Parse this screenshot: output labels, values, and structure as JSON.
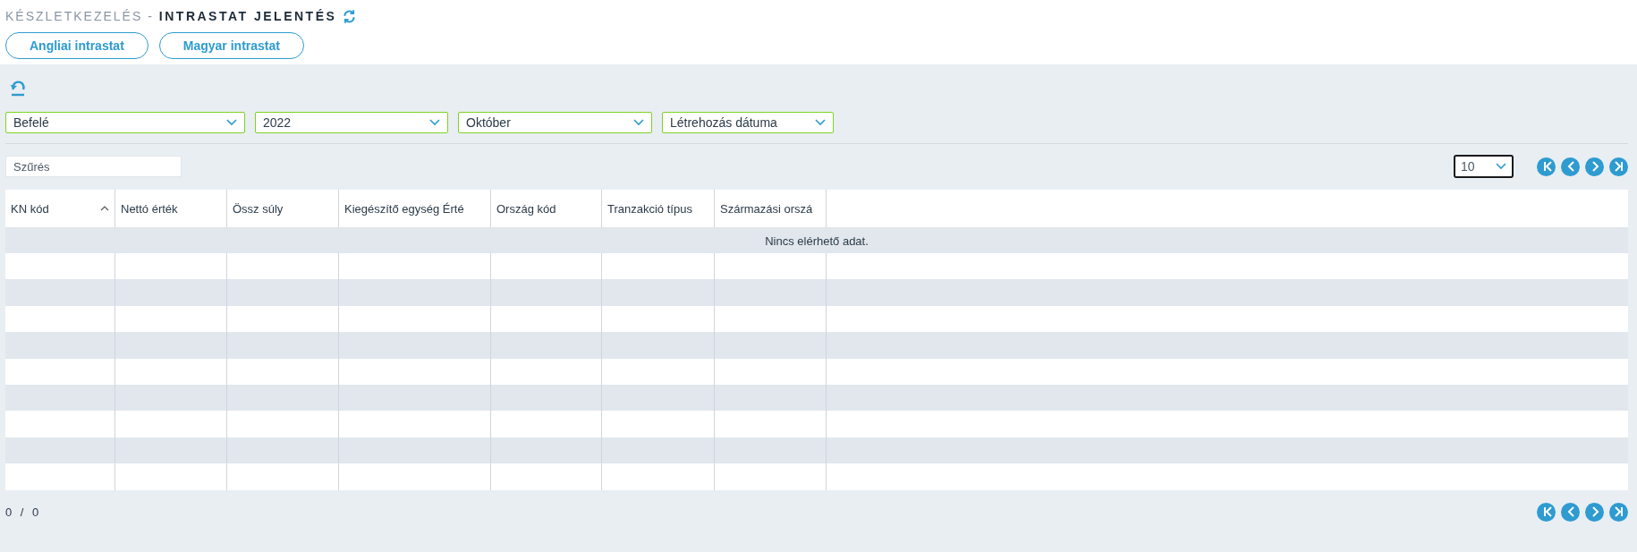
{
  "breadcrumb": {
    "parent": "KÉSZLETKEZELÉS -",
    "current": "INTRASTAT JELENTÉS"
  },
  "report_buttons": [
    "Angliai intrastat",
    "Magyar intrastat"
  ],
  "filters": [
    {
      "value": "Befelé"
    },
    {
      "value": "2022"
    },
    {
      "value": "Október"
    },
    {
      "value": "Létrehozás dátuma"
    }
  ],
  "search": {
    "placeholder": "Szűrés"
  },
  "page_size": "10",
  "table": {
    "columns": [
      {
        "label": "KN kód",
        "sorted": true
      },
      {
        "label": "Nettó érték",
        "sorted": false
      },
      {
        "label": "Össz súly",
        "sorted": false
      },
      {
        "label": "Kiegészítő egység Érté",
        "sorted": false
      },
      {
        "label": "Ország kód",
        "sorted": false
      },
      {
        "label": "Tranzakció típus",
        "sorted": false
      },
      {
        "label": "Származási orszá",
        "sorted": false
      }
    ],
    "empty_message": "Nincs elérhető adat."
  },
  "footer": {
    "page_from": "0",
    "separator": "/",
    "page_to": "0"
  }
}
